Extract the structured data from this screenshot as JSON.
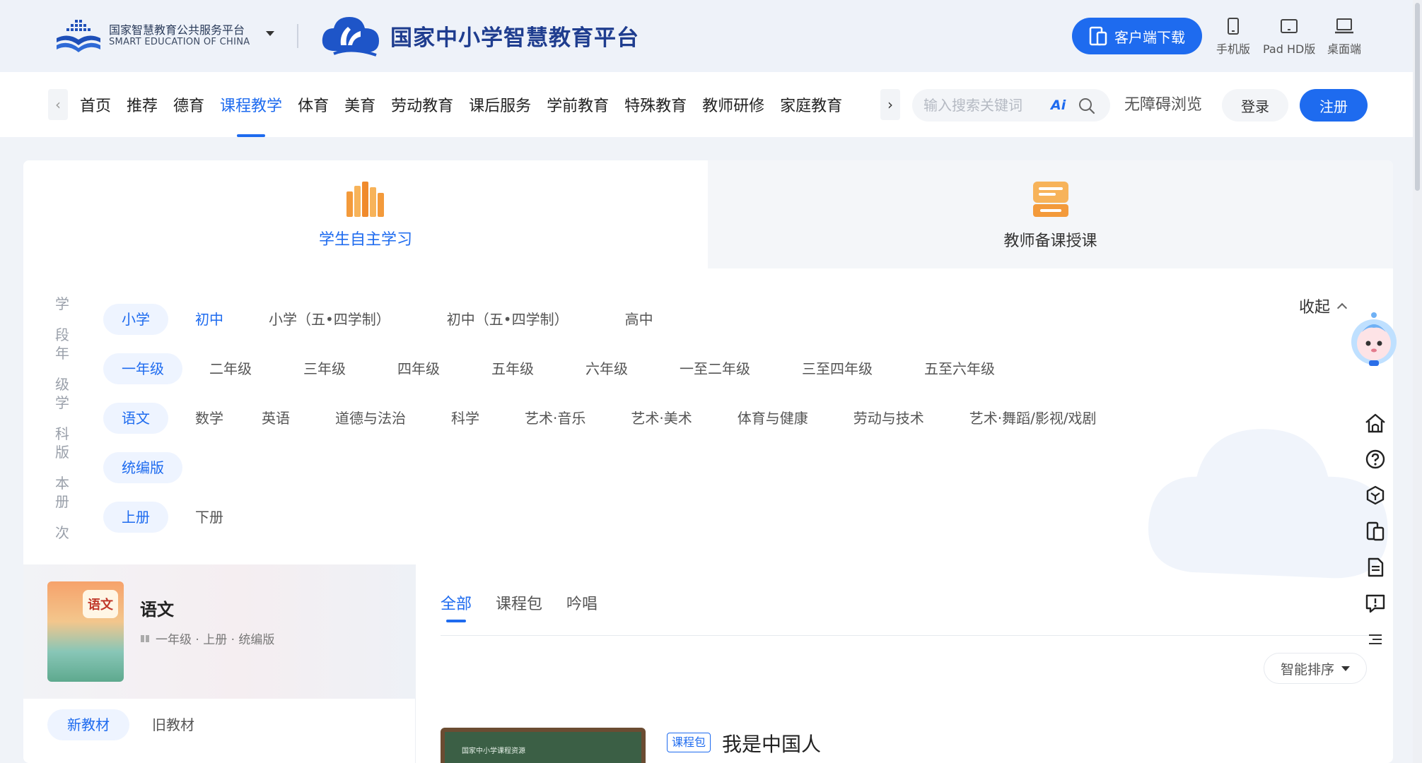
{
  "header": {
    "platform_cn": "国家智慧教育公共服务平台",
    "platform_en": "SMART EDUCATION OF CHINA",
    "main_title": "国家中小学智慧教育平台",
    "download_label": "客户端下载",
    "devices": [
      {
        "label": "手机版",
        "icon": "phone-icon"
      },
      {
        "label": "Pad HD版",
        "icon": "tablet-icon"
      },
      {
        "label": "桌面端",
        "icon": "desktop-icon"
      }
    ]
  },
  "nav": {
    "items": [
      "首页",
      "推荐",
      "德育",
      "课程教学",
      "体育",
      "美育",
      "劳动教育",
      "课后服务",
      "学前教育",
      "特殊教育",
      "教师研修",
      "家庭教育"
    ],
    "active_index": 3,
    "search_placeholder": "输入搜索关键词",
    "search_value": "",
    "ai_label": "Ai",
    "accessibility_label": "无障碍浏览",
    "login_label": "登录",
    "register_label": "注册"
  },
  "role_tabs": [
    {
      "label": "学生自主学习",
      "icon": "books-icon",
      "active": true
    },
    {
      "label": "教师备课授课",
      "icon": "teacher-desk-icon",
      "active": false
    }
  ],
  "collapse_label": "收起",
  "filters": [
    {
      "label": "学段",
      "options": [
        "小学",
        "初中",
        "小学（五•四学制）",
        "初中（五•四学制）",
        "高中"
      ],
      "selected": 0,
      "highlight": [
        1
      ]
    },
    {
      "label": "年级",
      "options": [
        "一年级",
        "二年级",
        "三年级",
        "四年级",
        "五年级",
        "六年级",
        "一至二年级",
        "三至四年级",
        "五至六年级"
      ],
      "selected": 0,
      "highlight": []
    },
    {
      "label": "学科",
      "options": [
        "语文",
        "数学",
        "英语",
        "道德与法治",
        "科学",
        "艺术·音乐",
        "艺术·美术",
        "体育与健康",
        "劳动与技术",
        "艺术·舞蹈/影视/戏剧"
      ],
      "selected": 0,
      "highlight": []
    },
    {
      "label": "版本",
      "options": [
        "统编版"
      ],
      "selected": 0,
      "highlight": []
    },
    {
      "label": "册次",
      "options": [
        "上册",
        "下册"
      ],
      "selected": 0,
      "highlight": []
    }
  ],
  "book": {
    "cover_badge": "语文",
    "title": "语文",
    "meta": "一年级 · 上册 · 统编版",
    "editions": [
      "新教材",
      "旧教材"
    ],
    "edition_selected": 0
  },
  "content": {
    "tabs": [
      "全部",
      "课程包",
      "吟唱"
    ],
    "active_tab": 0,
    "sort_label": "智能排序",
    "resource": {
      "thumb_text": "国家中小学课程资源",
      "tag": "课程包",
      "title": "我是中国人"
    }
  },
  "colors": {
    "primary": "#1e6bef",
    "header_bg": "#eef2f9",
    "selected_bg": "#eef4ff"
  }
}
